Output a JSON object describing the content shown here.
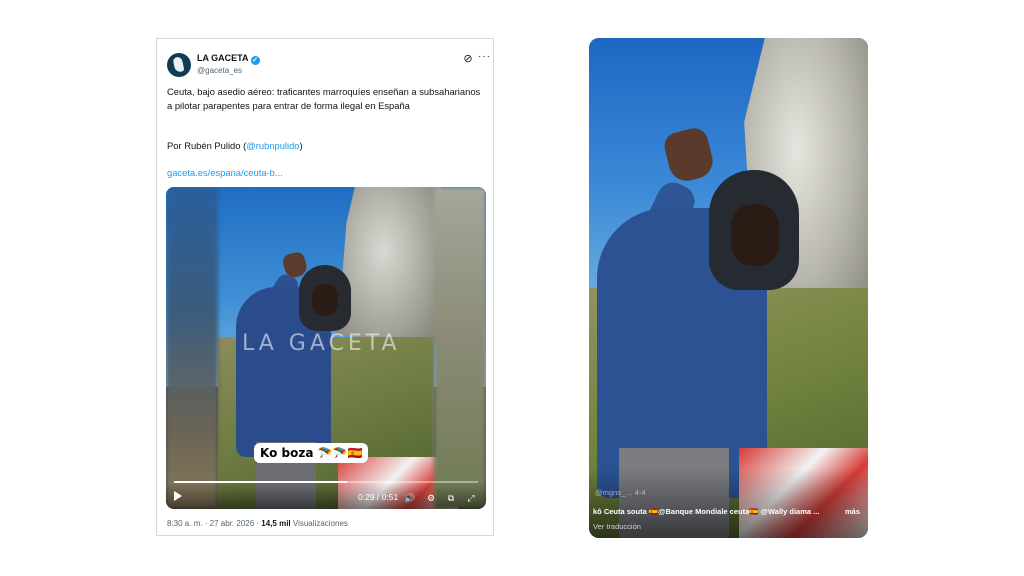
{
  "tweet": {
    "author": "LA GACETA",
    "handle": "@gaceta_es",
    "text": "Ceuta, bajo asedio aéreo: traficantes marroquíes enseñan a subsaharianos a pilotar parapentes para entrar de forma ilegal en España",
    "byline_prefix": "Por Rubén Pulido (",
    "byline_mention": "@rubnpulido",
    "byline_suffix": ")",
    "link": "gaceta.es/espana/ceuta-b...",
    "timestamp": "8:30 a. m. · 27 abr. 2026 ·",
    "views_count": "14,5 mil",
    "views_label": "Visualizaciones",
    "video": {
      "watermark": "LA GACETA",
      "caption": "Ko boza 🪂🪂🇪🇸",
      "time": "0:29 / 0:51",
      "progress": 0.57
    }
  },
  "phone_video": {
    "user": "@mgns_…  4-4",
    "caption": "kô Ceuta souta 🇪🇸@Banque Mondiale ceuta🇪🇸 @Wally diama ...",
    "more": "más",
    "translate": "Ver traducción"
  },
  "colors": {
    "link": "#1d9bf0",
    "text": "#0f1419",
    "muted": "#536471"
  }
}
